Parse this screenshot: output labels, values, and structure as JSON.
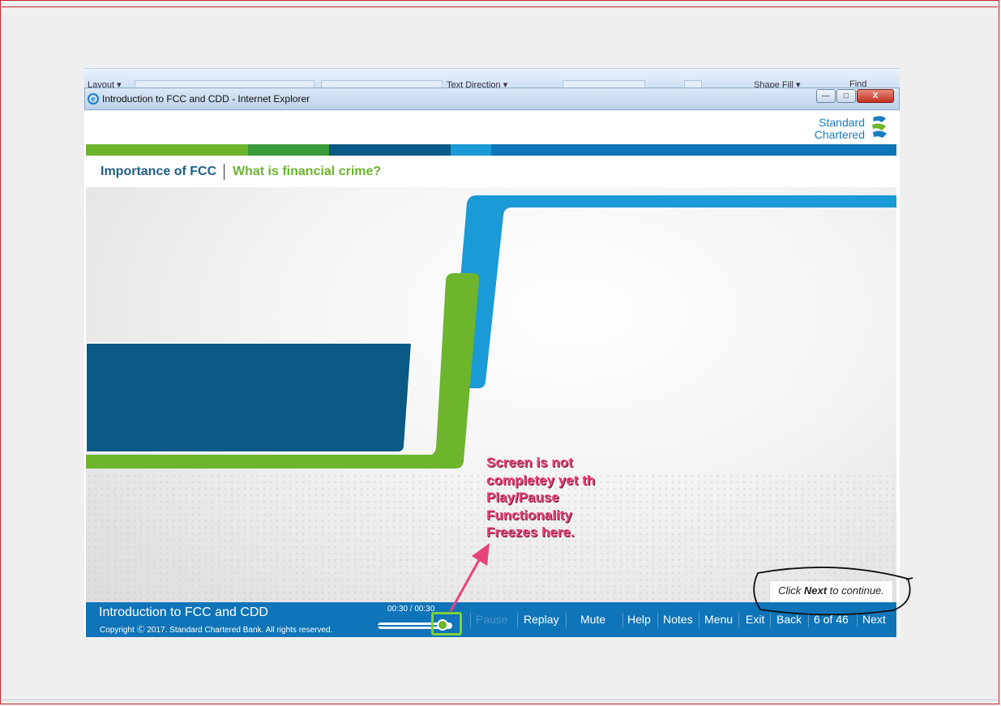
{
  "ribbon": {
    "layout_label": "Layout ▾",
    "text_direction_label": "Text Direction ▾",
    "shape_fill_label": "Shape Fill ▾",
    "find_label": "Find"
  },
  "window": {
    "title": "Introduction to FCC and CDD - Internet Explorer",
    "minimize_glyph": "—",
    "maximize_glyph": "□",
    "close_glyph": "X"
  },
  "brand": {
    "line1": "Standard",
    "line2": "Chartered"
  },
  "breadcrumb": {
    "section": "Importance of FCC",
    "topic": "What is financial crime?"
  },
  "notice": {
    "prefix": "Click ",
    "emphasis": "Next",
    "suffix": " to continue."
  },
  "footer": {
    "course_title": "Introduction to FCC and CDD",
    "copyright": "Copyright Ⓒ 2017. Standard Chartered Bank. All rights reserved.",
    "time_readout": "00:30 / 00:30",
    "progress": 0.87
  },
  "nav": {
    "pause": "Pause",
    "replay": "Replay",
    "mute": "Mute",
    "help": "Help",
    "notes": "Notes",
    "menu": "Menu",
    "exit": "Exit",
    "back": "Back",
    "page_indicator": "6 of 46",
    "next": "Next"
  },
  "annotation": {
    "lines": [
      "Screen is not",
      "completey yet th",
      "Play/Pause",
      "Functionality",
      "Freezes here."
    ]
  },
  "colors": {
    "green": "#6cb52d",
    "dark_green": "#3a9b3a",
    "navy": "#0a5a85",
    "light_blue": "#1a9ad6",
    "footer_blue": "#0f74b8",
    "annotation_pink": "#e8437a"
  }
}
